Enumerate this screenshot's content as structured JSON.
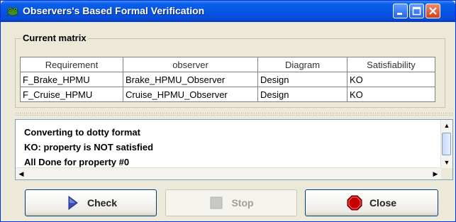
{
  "window": {
    "title": "Observers's Based Formal Verification",
    "icons": {
      "app": "frog-icon",
      "minimize": "minimize-icon",
      "maximize": "maximize-icon",
      "close": "close-icon"
    }
  },
  "matrix": {
    "title": "Current matrix",
    "columns": [
      "Requirement",
      "observer",
      "Diagram",
      "Satisfiability"
    ],
    "rows": [
      [
        "F_Brake_HPMU",
        "Brake_HPMU_Observer",
        "Design",
        "KO"
      ],
      [
        "F_Cruise_HPMU",
        "Cruise_HPMU_Observer",
        "Design",
        "KO"
      ]
    ]
  },
  "log": {
    "lines": [
      "Converting to dotty format",
      "KO: property is NOT satisfied",
      "All Done for property #0"
    ]
  },
  "buttons": {
    "check": {
      "label": "Check",
      "icon": "play-arrow-icon"
    },
    "stop": {
      "label": "Stop",
      "icon": "stop-square-icon",
      "enabled": false
    },
    "close": {
      "label": "Close",
      "icon": "stop-sign-icon"
    }
  },
  "colors": {
    "titlebar": "#0553e2",
    "window_bg": "#ece9d8",
    "close_icon": "#c40000",
    "check_arrow": "#3b4fb8"
  }
}
